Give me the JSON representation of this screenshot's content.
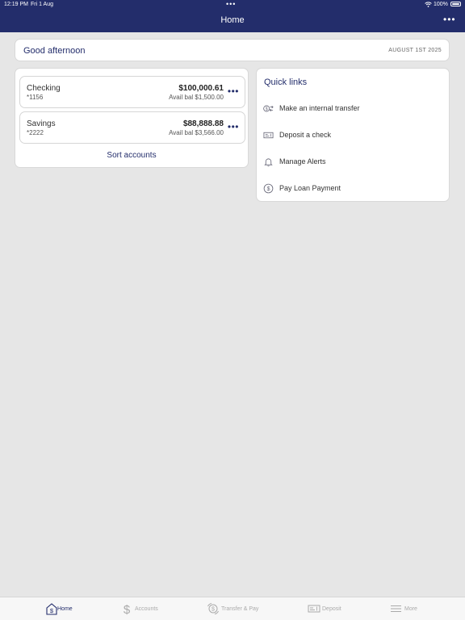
{
  "status": {
    "time": "12:19 PM",
    "date": "Fri 1 Aug",
    "dots": "•••",
    "battery_pct": "100%"
  },
  "header": {
    "title": "Home",
    "more": "•••"
  },
  "greeting": {
    "text": "Good afternoon",
    "date": "AUGUST 1ST 2025"
  },
  "accounts": {
    "items": [
      {
        "name": "Checking",
        "number": "*1156",
        "balance": "$100,000.61",
        "avail": "Avail bal $1,500.00",
        "more": "•••"
      },
      {
        "name": "Savings",
        "number": "*2222",
        "balance": "$88,888.88",
        "avail": "Avail bal $3,566.00",
        "more": "•••"
      }
    ],
    "sort_label": "Sort accounts"
  },
  "quick_links": {
    "title": "Quick links",
    "items": [
      {
        "label": "Make an internal transfer",
        "icon": "transfer-icon"
      },
      {
        "label": "Deposit a check",
        "icon": "check-deposit-icon"
      },
      {
        "label": "Manage Alerts",
        "icon": "bell-icon"
      },
      {
        "label": "Pay Loan Payment",
        "icon": "dollar-circle-icon"
      }
    ]
  },
  "tabs": [
    {
      "label": "Home",
      "icon": "home-dollar-icon",
      "active": true
    },
    {
      "label": "Accounts",
      "icon": "dollar-icon",
      "active": false
    },
    {
      "label": "Transfer & Pay",
      "icon": "transfer-pay-icon",
      "active": false
    },
    {
      "label": "Deposit",
      "icon": "check-deposit-icon",
      "active": false
    },
    {
      "label": "More",
      "icon": "menu-icon",
      "active": false
    }
  ],
  "colors": {
    "brand": "#232d6b",
    "background": "#e6e6e6",
    "card": "#ffffff",
    "inactive_tab": "#aaaaaa"
  }
}
